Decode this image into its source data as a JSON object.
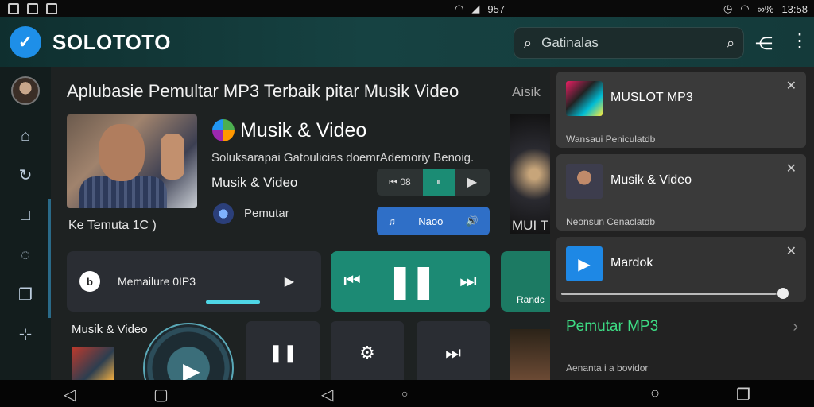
{
  "status_bar": {
    "mid_text": "957",
    "right_text": "13:58",
    "signal_text": "∞%"
  },
  "app_bar": {
    "title": "SOLOTOTO",
    "logo_glyph": "✓",
    "search_placeholder": "Gatinalas"
  },
  "main": {
    "headline": "Aplubasie Pemultar MP3 Terbaik pitar Musik Video",
    "card": {
      "title": "Musik & Video",
      "description": "Soluksarapai Gatoulicias doemrAdemoriy Benoig.",
      "subtitle": "Musik & Video",
      "pill_left": "⏮ 08",
      "pill_mid": "⏸",
      "pill_right": "▶",
      "player_label": "Pemutar",
      "blue_left": "♫",
      "blue_mid": "Naoo",
      "blue_right": "🔊"
    },
    "ke_label": "Ke  Temuta 1C  )",
    "mp3_card": {
      "label": "Memailure 0IP3",
      "logo_glyph": "b",
      "right_glyph": "▶"
    },
    "controls": {
      "prev": "⏮",
      "pause": "❚❚",
      "next": "⏭"
    },
    "row3_label": "Musik & Video",
    "tiles": [
      {
        "glyph": "❚❚"
      },
      {
        "glyph": "⚙"
      },
      {
        "glyph": "⏭"
      }
    ],
    "peek": {
      "label": "Aisik",
      "mu": "MUI T",
      "green_label": "Randc"
    }
  },
  "panel": {
    "notifications": [
      {
        "title": "MUSLOT MP3",
        "subtitle": "Wansaui Peniculatdb"
      },
      {
        "title": "Musik & Video",
        "subtitle": "Neonsun Cenaclatdb"
      },
      {
        "title": "Mardok",
        "subtitle": ""
      }
    ],
    "slider_value": 0.97,
    "link": "Pemutar MP3",
    "footer": "Aenanta i a bovidor"
  },
  "colors": {
    "accent_green": "#1c8a74",
    "accent_blue": "#2f6fc7",
    "link_green": "#3ddc84"
  }
}
